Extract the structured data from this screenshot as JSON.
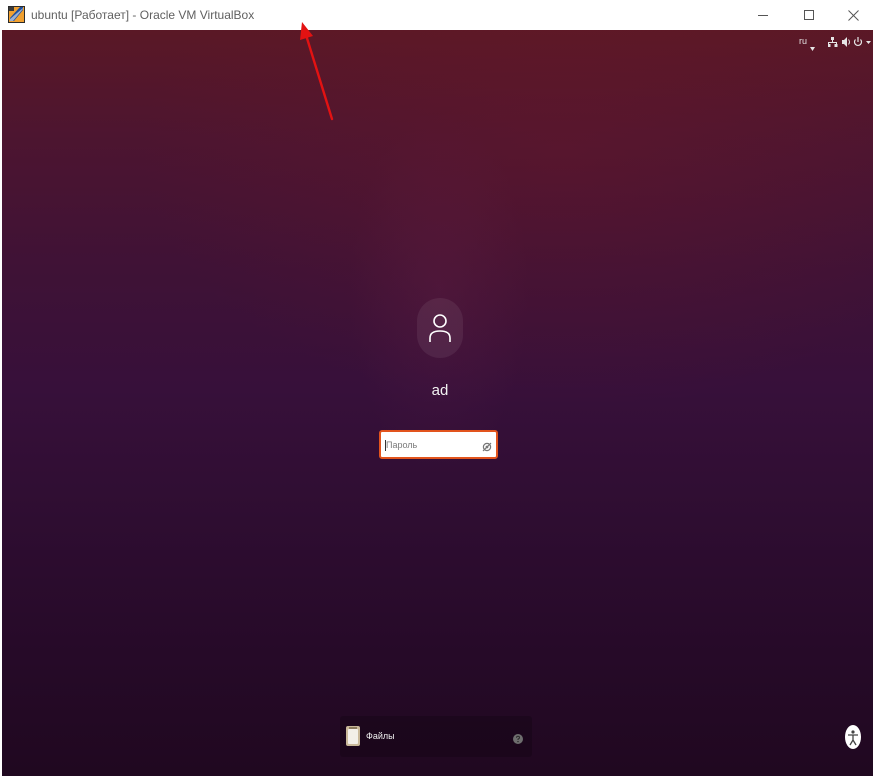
{
  "window": {
    "title": "ubuntu [Работает] - Oracle VM VirtualBox",
    "icon": "virtualbox-icon",
    "controls": [
      "minimize-icon",
      "maximize-icon",
      "close-icon"
    ]
  },
  "topbar": {
    "keyboard_layout": "ru",
    "indicators": [
      "network-icon",
      "volume-icon",
      "power-icon",
      "chevron-down-icon"
    ]
  },
  "login": {
    "username": "ad",
    "avatar_icon": "user-avatar-icon",
    "password": {
      "value": "",
      "placeholder": "Пароль"
    }
  },
  "dock": {
    "files_label": "Файлы"
  },
  "colors": {
    "accent": "#e2541d",
    "annotation": "#e31212",
    "background_top": "#5a1826",
    "background_bottom": "#200820"
  }
}
